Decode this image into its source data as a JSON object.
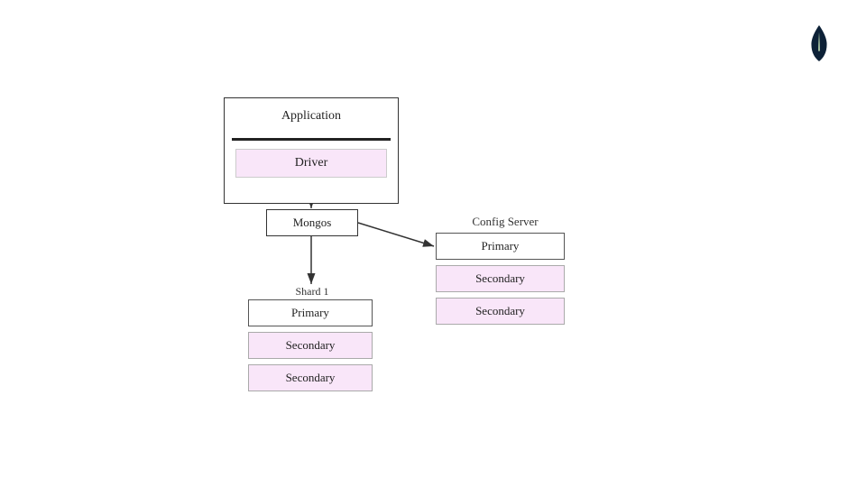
{
  "logo": {
    "alt": "MongoDB leaf"
  },
  "app_driver": {
    "application_label": "Application",
    "driver_label": "Driver"
  },
  "mongos": {
    "label": "Mongos"
  },
  "shard1": {
    "title": "Shard 1",
    "primary_label": "Primary",
    "secondary1_label": "Secondary",
    "secondary2_label": "Secondary"
  },
  "config_server": {
    "title": "Config Server",
    "primary_label": "Primary",
    "secondary1_label": "Secondary",
    "secondary2_label": "Secondary"
  }
}
